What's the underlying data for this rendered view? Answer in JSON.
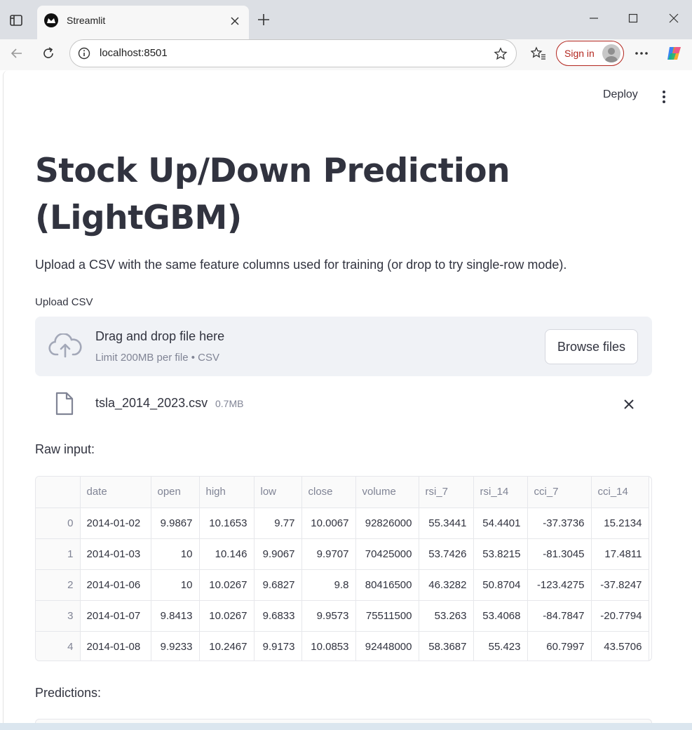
{
  "browser": {
    "tab_title": "Streamlit",
    "url": "localhost:8501",
    "signin_label": "Sign in"
  },
  "app": {
    "deploy_label": "Deploy",
    "title_line1": "Stock Up/Down Prediction",
    "title_line2": "(LightGBM)",
    "intro": "Upload a CSV with the same feature columns used for training (or drop to try single-row mode).",
    "upload_label": "Upload CSV",
    "dropzone_title": "Drag and drop file here",
    "dropzone_limit": "Limit 200MB per file • CSV",
    "browse_label": "Browse files",
    "file_name": "tsla_2014_2023.csv",
    "file_size": "0.7MB",
    "raw_label": "Raw input:",
    "predictions_label": "Predictions:"
  },
  "table": {
    "columns": [
      "",
      "date",
      "open",
      "high",
      "low",
      "close",
      "volume",
      "rsi_7",
      "rsi_14",
      "cci_7",
      "cci_14"
    ],
    "rows": [
      [
        "0",
        "2014-01-02",
        "9.9867",
        "10.1653",
        "9.77",
        "10.0067",
        "92826000",
        "55.3441",
        "54.4401",
        "-37.3736",
        "15.2134"
      ],
      [
        "1",
        "2014-01-03",
        "10",
        "10.146",
        "9.9067",
        "9.9707",
        "70425000",
        "53.7426",
        "53.8215",
        "-81.3045",
        "17.4811"
      ],
      [
        "2",
        "2014-01-06",
        "10",
        "10.0267",
        "9.6827",
        "9.8",
        "80416500",
        "46.3282",
        "50.8704",
        "-123.4275",
        "-37.8247"
      ],
      [
        "3",
        "2014-01-07",
        "9.8413",
        "10.0267",
        "9.6833",
        "9.9573",
        "75511500",
        "53.263",
        "53.4068",
        "-84.7847",
        "-20.7794"
      ],
      [
        "4",
        "2014-01-08",
        "9.9233",
        "10.2467",
        "9.9173",
        "10.0853",
        "92448000",
        "58.3687",
        "55.423",
        "60.7997",
        "43.5706"
      ]
    ]
  },
  "colors": {
    "text": "#31333f",
    "muted": "#808495",
    "dropzone_bg": "#f0f2f6",
    "signin_accent": "#b3261e"
  }
}
